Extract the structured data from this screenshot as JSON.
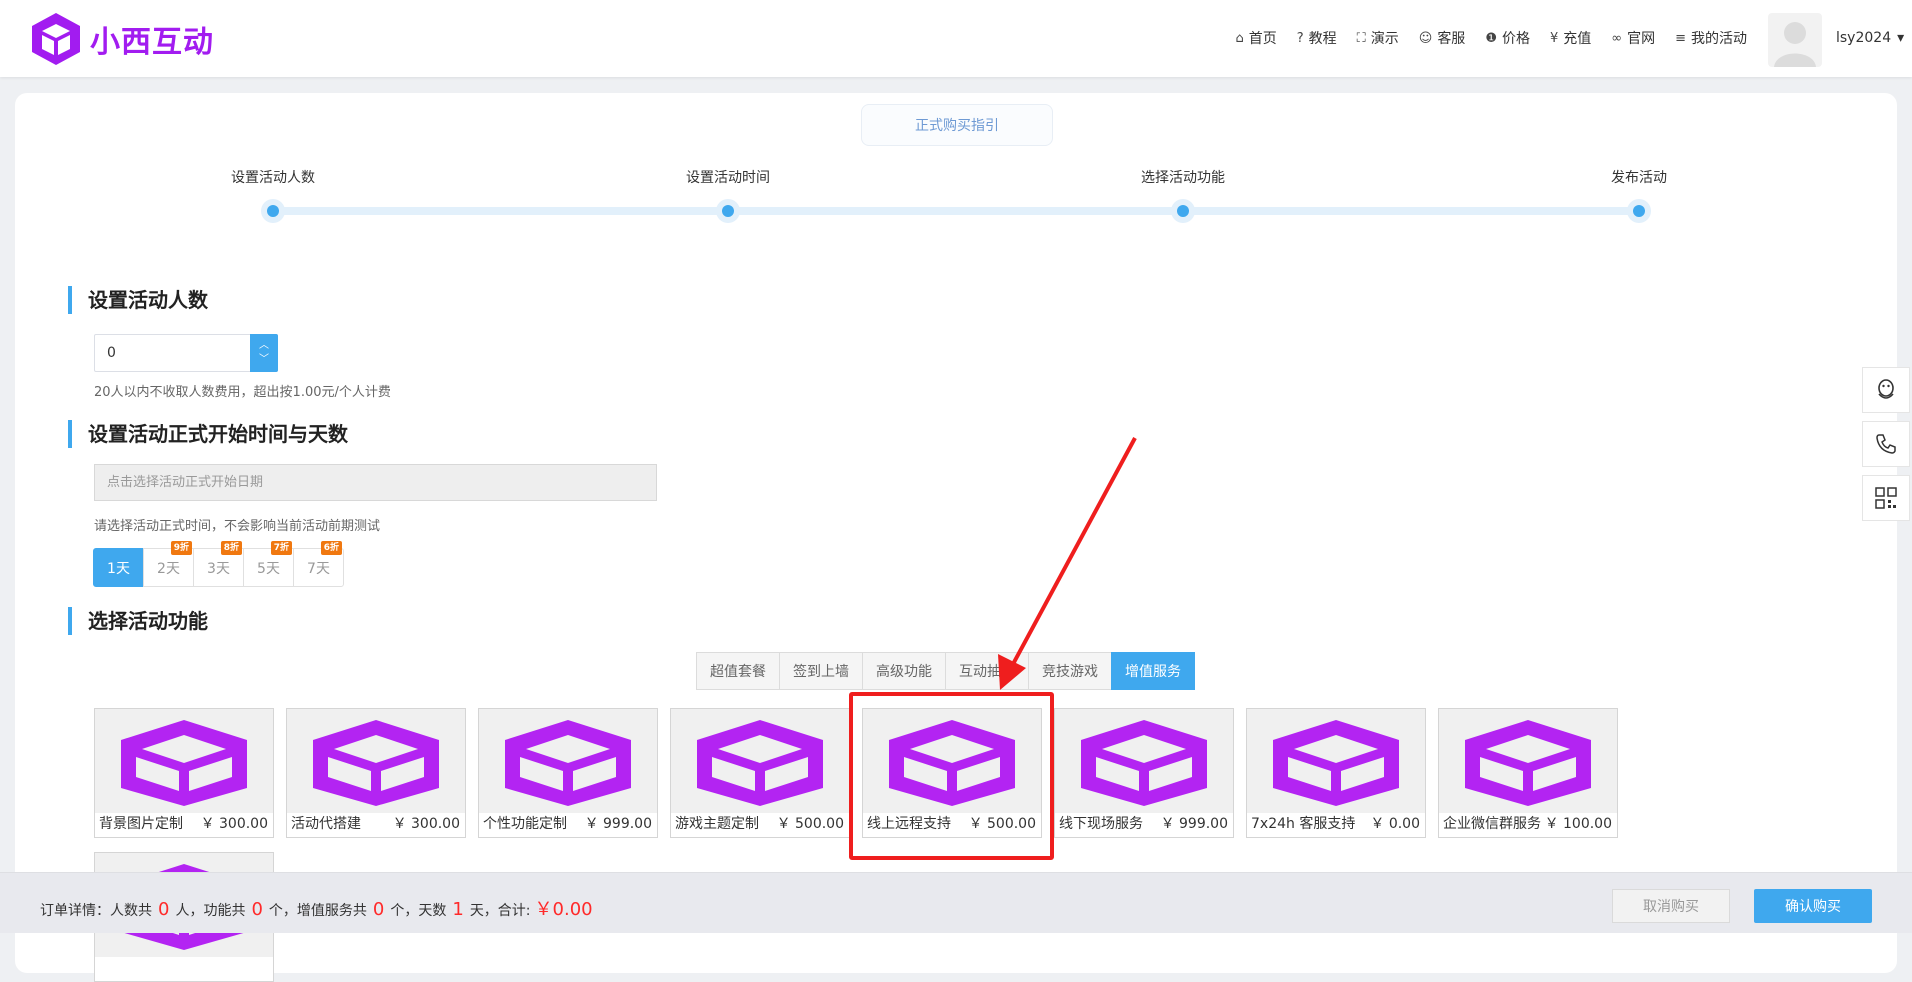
{
  "header": {
    "logo_text": "小西互动",
    "nav": [
      {
        "icon": "⌂",
        "label": "首页"
      },
      {
        "icon": "?",
        "label": "教程"
      },
      {
        "icon": "⛶",
        "label": "演示"
      },
      {
        "icon": "☺",
        "label": "客服"
      },
      {
        "icon": "❶",
        "label": "价格"
      },
      {
        "icon": "¥",
        "label": "充值"
      },
      {
        "icon": "∞",
        "label": "官网"
      },
      {
        "icon": "≡",
        "label": "我的活动"
      }
    ],
    "username": "lsy2024",
    "user_caret": "▾"
  },
  "guide_button": "正式购买指引",
  "steps": [
    "设置活动人数",
    "设置活动时间",
    "选择活动功能",
    "发布活动"
  ],
  "section_people": {
    "title": "设置活动人数",
    "value": "0",
    "hint": "20人以内不收取人数费用，超出按1.00元/个人计费"
  },
  "section_time": {
    "title": "设置活动正式开始时间与天数",
    "date_placeholder": "点击选择活动正式开始日期",
    "hint": "请选择活动正式时间，不会影响当前活动前期测试",
    "days": [
      {
        "label": "1天",
        "badge": ""
      },
      {
        "label": "2天",
        "badge": "9折"
      },
      {
        "label": "3天",
        "badge": "8折"
      },
      {
        "label": "5天",
        "badge": "7折"
      },
      {
        "label": "7天",
        "badge": "6折"
      }
    ]
  },
  "section_features": {
    "title": "选择活动功能",
    "tabs": [
      "超值套餐",
      "签到上墙",
      "高级功能",
      "互动抽奖",
      "竞技游戏",
      "增值服务"
    ],
    "active_tab": "增值服务",
    "items": [
      {
        "name": "背景图片定制",
        "price": "￥ 300.00"
      },
      {
        "name": "活动代搭建",
        "price": "￥ 300.00"
      },
      {
        "name": "个性功能定制",
        "price": "￥ 999.00"
      },
      {
        "name": "游戏主题定制",
        "price": "￥ 500.00"
      },
      {
        "name": "线上远程支持",
        "price": "￥ 500.00"
      },
      {
        "name": "线下现场服务",
        "price": "￥ 999.00"
      },
      {
        "name": "7x24h 客服支持",
        "price": "￥ 0.00"
      },
      {
        "name": "企业微信群服务",
        "price": "￥ 100.00"
      }
    ]
  },
  "footer": {
    "order_prefix": "订单详情：人数共",
    "people": "0",
    "unit_people": "人，功能共",
    "features": "0",
    "unit_features": "个，增值服务共",
    "services": "0",
    "unit_services": "个，天数",
    "days": "1",
    "unit_days": "天，合计:",
    "total": "￥0.00",
    "cancel_label": "取消购买",
    "confirm_label": "确认购买"
  },
  "colors": {
    "brand": "#a21cf0",
    "accent": "#3fa8ee",
    "highlight": "#ef1e1e",
    "badge": "#f07810"
  }
}
